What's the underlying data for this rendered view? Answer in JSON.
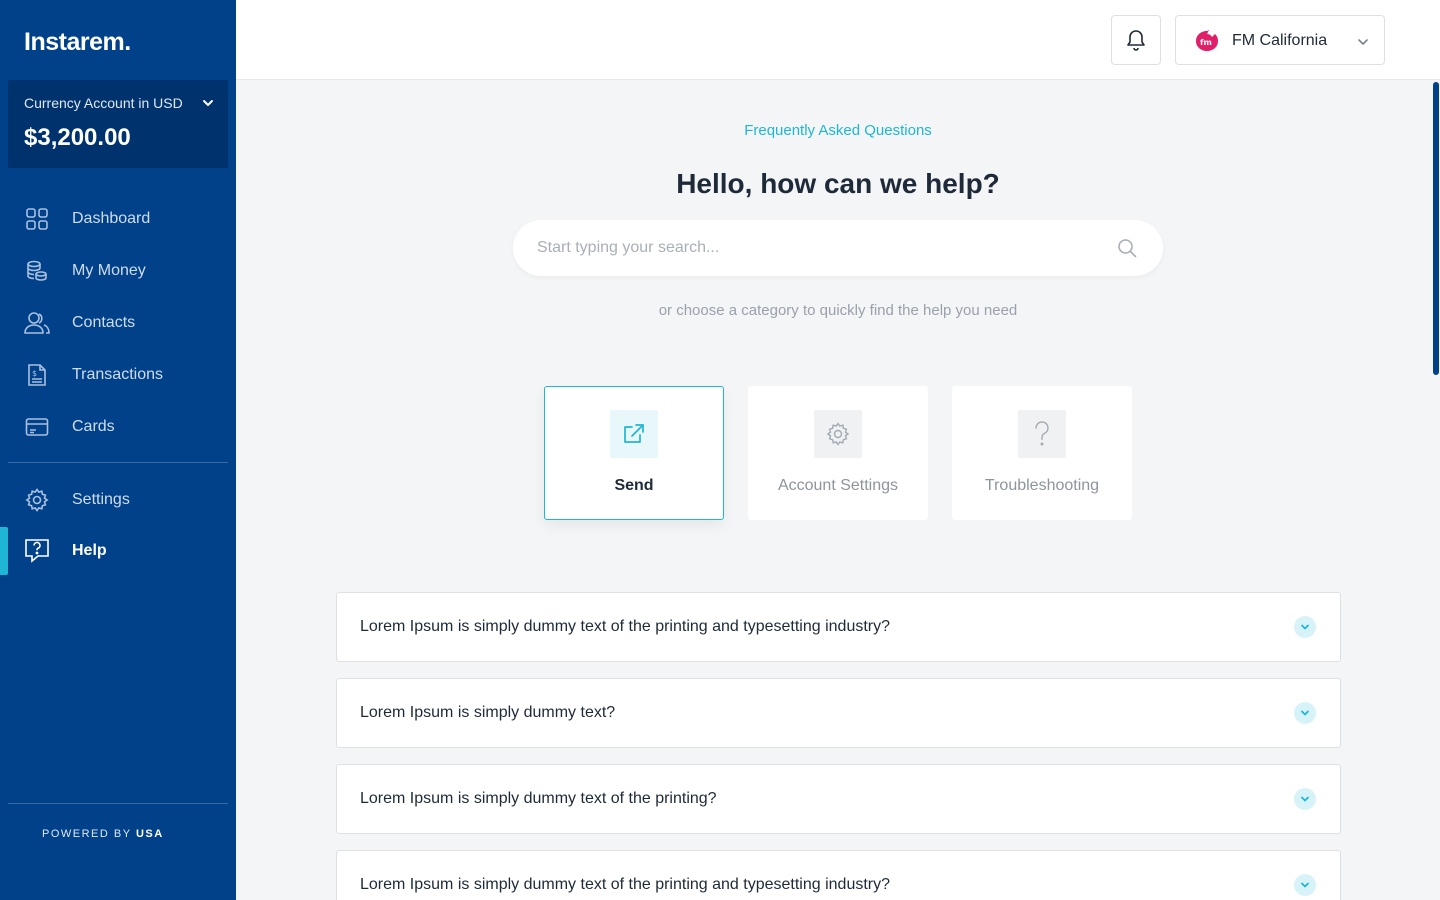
{
  "brand": {
    "logo_text": "Instarem.",
    "accent": "#1fb6d6",
    "sidebar_bg": "#00418a"
  },
  "account": {
    "label": "Currency Account in USD",
    "balance": "$3,200.00"
  },
  "sidebar": {
    "items": [
      {
        "label": "Dashboard",
        "icon": "dashboard-grid-icon"
      },
      {
        "label": "My Money",
        "icon": "coins-stack-icon"
      },
      {
        "label": "Contacts",
        "icon": "users-icon"
      },
      {
        "label": "Transactions",
        "icon": "receipt-icon"
      },
      {
        "label": "Cards",
        "icon": "credit-card-icon"
      }
    ],
    "secondary": [
      {
        "label": "Settings",
        "icon": "gear-icon"
      },
      {
        "label": "Help",
        "icon": "help-chat-icon",
        "active": true
      }
    ],
    "powered_by_prefix": "POWERED BY",
    "powered_by_brand": "USA"
  },
  "topbar": {
    "company_name": "FM California",
    "company_logo_text": "fm"
  },
  "help": {
    "eyebrow": "Frequently Asked Questions",
    "title": "Hello, how can we help?",
    "search_placeholder": "Start typing your search...",
    "helper_text": "or choose a category to quickly find the help you need"
  },
  "categories": [
    {
      "label": "Send",
      "icon": "external-link-icon",
      "selected": true
    },
    {
      "label": "Account Settings",
      "icon": "gear-icon",
      "selected": false
    },
    {
      "label": "Troubleshooting",
      "icon": "question-mark-icon",
      "selected": false
    }
  ],
  "faqs": [
    "Lorem Ipsum is simply dummy text of the printing and typesetting industry?",
    "Lorem Ipsum is simply dummy text?",
    "Lorem Ipsum is simply dummy text of the printing?",
    "Lorem Ipsum is simply dummy text of the printing and typesetting industry?"
  ]
}
